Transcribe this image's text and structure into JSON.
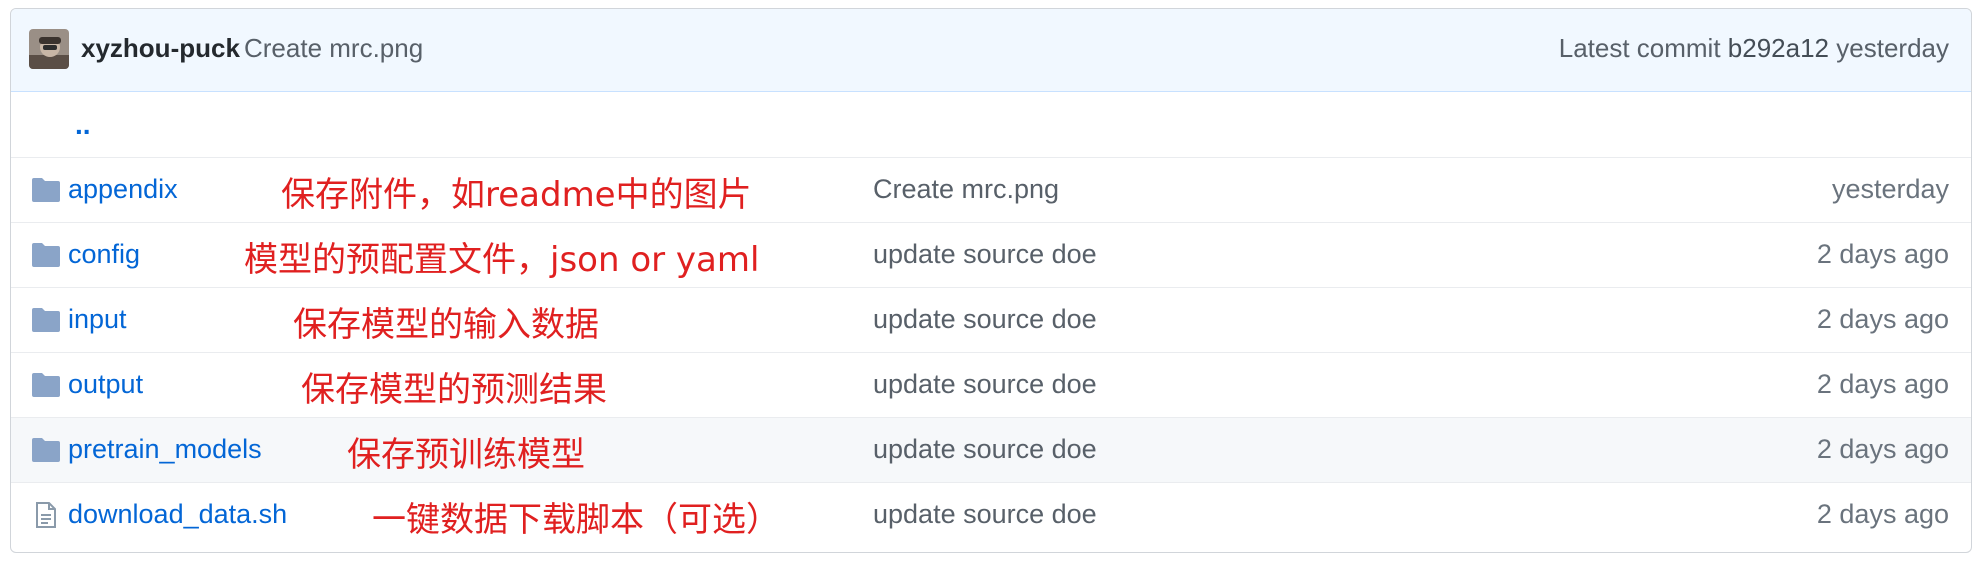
{
  "commit": {
    "author": "xyzhou-puck",
    "message": "Create mrc.png",
    "latest_label": "Latest commit",
    "sha": "b292a12",
    "age": "yesterday"
  },
  "up_link": "..",
  "files": [
    {
      "type": "folder",
      "name": "appendix",
      "note": "保存附件，如readme中的图片",
      "message": "Create mrc.png",
      "age": "yesterday"
    },
    {
      "type": "folder",
      "name": "config",
      "note": "模型的预配置文件，json or yaml",
      "message": "update source doe",
      "age": "2 days ago"
    },
    {
      "type": "folder",
      "name": "input",
      "note": "保存模型的输入数据",
      "message": "update source doe",
      "age": "2 days ago"
    },
    {
      "type": "folder",
      "name": "output",
      "note": "保存模型的预测结果",
      "message": "update source doe",
      "age": "2 days ago"
    },
    {
      "type": "folder",
      "name": "pretrain_models",
      "note": "保存预训练模型",
      "message": "update source doe",
      "age": "2 days ago"
    },
    {
      "type": "file",
      "name": "download_data.sh",
      "note": "一键数据下载脚本（可选）",
      "message": "update source doe",
      "age": "2 days ago"
    }
  ],
  "colors": {
    "link": "#0366d6",
    "annotation": "#e02020",
    "commit_bar": "#f1f8ff"
  }
}
